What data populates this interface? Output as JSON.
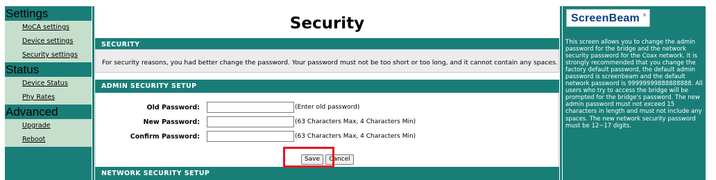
{
  "sidebar": {
    "groups": [
      {
        "title": "Settings",
        "items": [
          "MoCA settings",
          "Device settings",
          "Security settings"
        ]
      },
      {
        "title": "Status",
        "items": [
          "Device Status",
          "Phy Rates"
        ]
      },
      {
        "title": "Advanced",
        "items": [
          "Upgrade",
          "Reboot"
        ]
      }
    ]
  },
  "page": {
    "title": "Security"
  },
  "security_section": {
    "heading": "SECURITY",
    "note": "For security reasons, you had better change the password. Your password must not be too short or too long, and it cannot contain any spaces."
  },
  "admin_section": {
    "heading": "ADMIN SECURITY SETUP",
    "fields": [
      {
        "label": "Old Password:",
        "value": "",
        "hint": "(Enter old password)"
      },
      {
        "label": "New Password:",
        "value": "",
        "hint": "(63 Characters Max, 4 Characters Min)"
      },
      {
        "label": "Confirm Password:",
        "value": "",
        "hint": "(63 Characters Max, 4 Characters Min)"
      }
    ],
    "save_label": "Save",
    "cancel_label": "Cancel"
  },
  "network_section": {
    "heading": "NETWORK SECURITY SETUP"
  },
  "right_panel": {
    "brand": "ScreenBeam",
    "brand_mark": "®",
    "help_text": "This screen allows you to change the admin password for the bridge and the network security password for the Coax network. It is strongly recommended that you change the factory default password, the default admin password is screenbeam and the default network password is 99999999888888888. All users who try to access the bridge will be prompted for the bridge's password. The new admin password must not exceed 15 characters in length and must not include any spaces. The new network security password must be 12~17 digits."
  },
  "colors": {
    "teal": "#1a7e78",
    "nav_bg": "#c6dfcc",
    "highlight": "#e8151b",
    "brand_blue": "#0a3e85"
  }
}
